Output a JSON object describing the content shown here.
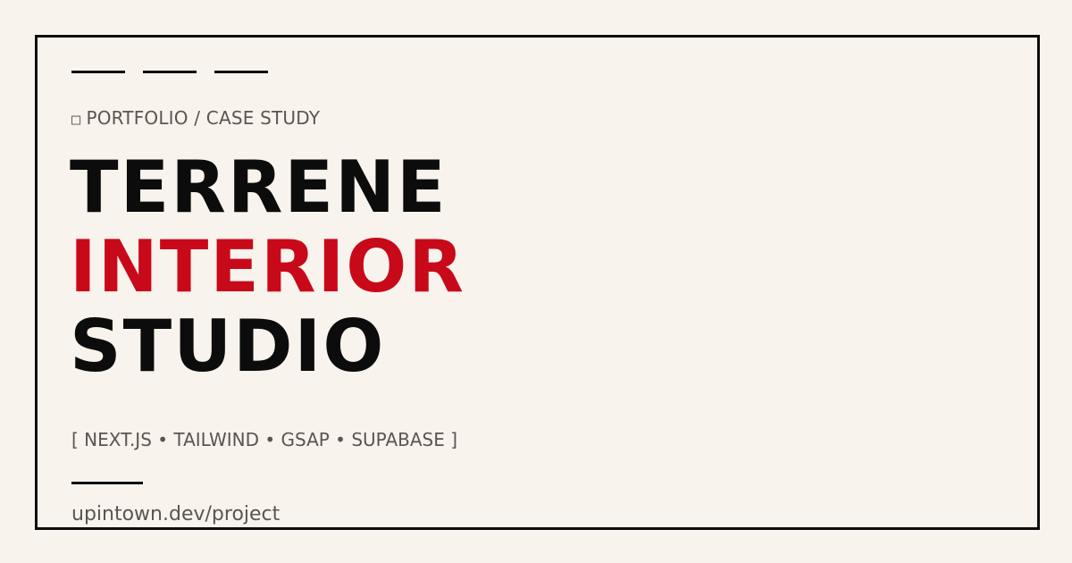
{
  "kicker": {
    "icon": "folder-icon",
    "icon_glyph": "□",
    "text": "PORTFOLIO / CASE STUDY"
  },
  "title": {
    "line1": "TERRENE",
    "line2": "INTERIOR",
    "line3": "STUDIO"
  },
  "stack": "[ NEXT.JS • TAILWIND • GSAP • SUPABASE ]",
  "url": "upintown.dev/project",
  "colors": {
    "background": "#f8f3ec",
    "ink": "#0c0c0c",
    "accent": "#c8091a",
    "muted": "#5a5550"
  }
}
